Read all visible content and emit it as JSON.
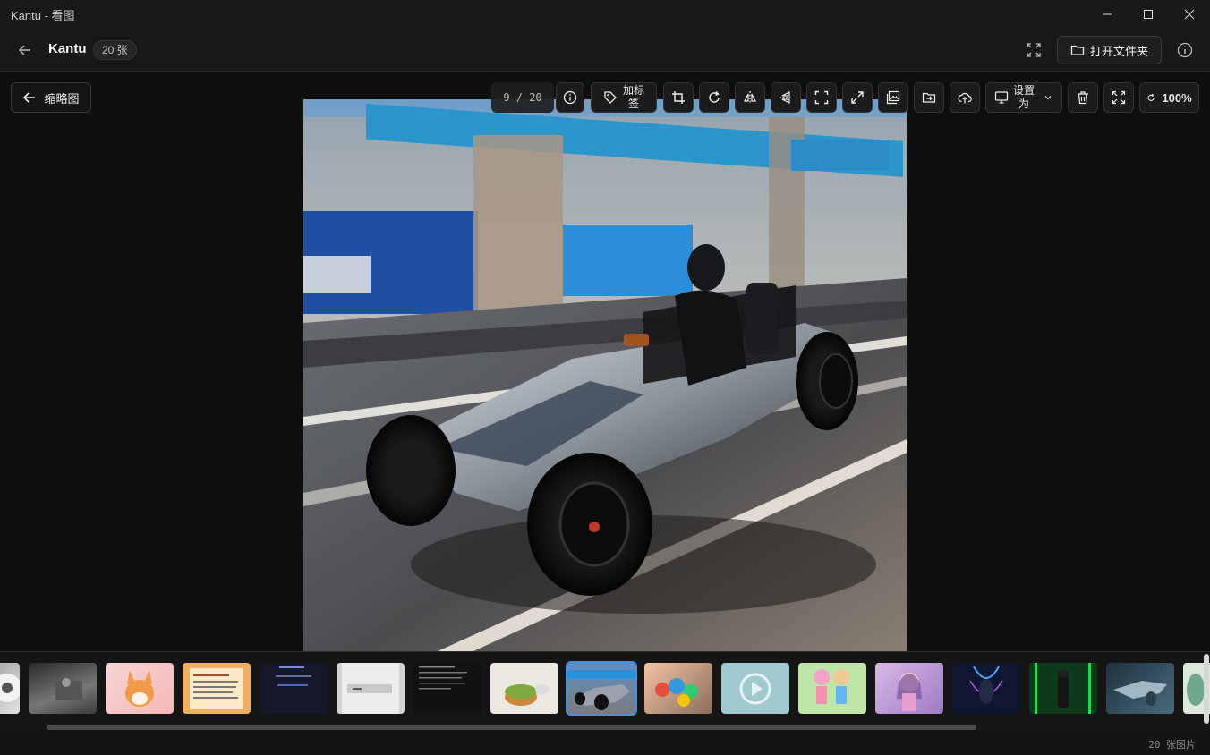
{
  "window": {
    "title": "Kantu - 看图"
  },
  "header": {
    "app_name": "Kantu",
    "count_badge": "20 张",
    "open_folder_label": "打开文件夹"
  },
  "viewer": {
    "thumbnails_button_label": "缩略图",
    "page_indicator": "9 / 20",
    "add_tag_line1": "加标",
    "add_tag_line2": "签",
    "set_as_line1": "设置",
    "set_as_line2": "为",
    "zoom_level": "100%"
  },
  "filmstrip": {
    "active_index": 8
  },
  "status": {
    "total": "20 张图片"
  },
  "colors": {
    "accent": "#4a8fe0",
    "background": "#0f0f0f",
    "panel": "#181818"
  }
}
